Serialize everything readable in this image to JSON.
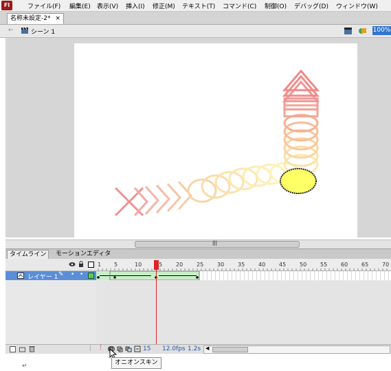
{
  "app": {
    "icon_text": "Fl"
  },
  "menu": [
    {
      "label": "ファイル(F)"
    },
    {
      "label": "編集(E)"
    },
    {
      "label": "表示(V)"
    },
    {
      "label": "挿入(I)"
    },
    {
      "label": "修正(M)"
    },
    {
      "label": "テキスト(T)"
    },
    {
      "label": "コマンド(C)"
    },
    {
      "label": "制御(O)"
    },
    {
      "label": "デバッグ(D)"
    },
    {
      "label": "ウィンドウ(W)"
    }
  ],
  "document_tab": {
    "title": "名称未設定-2*",
    "close": "×"
  },
  "editbar": {
    "back": "←",
    "scene_label": "シーン 1",
    "zoom": "100%"
  },
  "colors": {
    "selection": "#5b8ed6",
    "playhead": "#dd2222",
    "tween": "#c8f0c8",
    "onion_red": "#f08080",
    "onion_yellow": "#ffe8a0"
  },
  "timeline": {
    "tabs": [
      "タイムライン",
      "モーションエディタ"
    ],
    "ruler_ticks": [
      "1",
      "5",
      "10",
      "15",
      "20",
      "25",
      "30",
      "35",
      "40",
      "45",
      "50",
      "55",
      "60",
      "65",
      "70"
    ],
    "layer_name": "レイヤー 1",
    "layer_dots": [
      "•",
      "•"
    ],
    "current_frame": "15",
    "fps": "12.0fps",
    "elapsed": "1.2s"
  },
  "tooltip": "オニオンスキン"
}
